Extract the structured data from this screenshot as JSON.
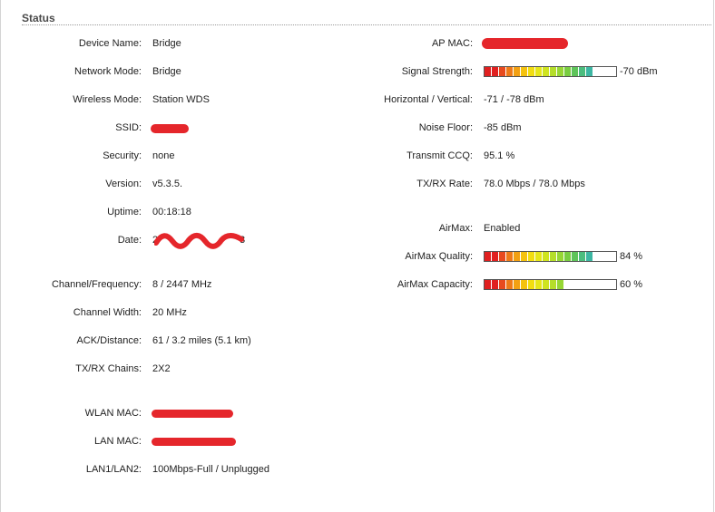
{
  "section_title": "Status",
  "left": {
    "device_name": {
      "label": "Device Name:",
      "value": "Bridge"
    },
    "network_mode": {
      "label": "Network Mode:",
      "value": "Bridge"
    },
    "wireless_mode": {
      "label": "Wireless Mode:",
      "value": "Station WDS"
    },
    "ssid": {
      "label": "SSID:",
      "value": ""
    },
    "security": {
      "label": "Security:",
      "value": "none"
    },
    "version": {
      "label": "Version:",
      "value": "v5.3.5."
    },
    "uptime": {
      "label": "Uptime:",
      "value": "00:18:18"
    },
    "date": {
      "label": "Date:",
      "value_start": "2",
      "value_end": "3"
    },
    "channel_frequency": {
      "label": "Channel/Frequency:",
      "value": "8 / 2447 MHz"
    },
    "channel_width": {
      "label": "Channel Width:",
      "value": "20 MHz"
    },
    "ack_distance": {
      "label": "ACK/Distance:",
      "value": "61 / 3.2 miles (5.1 km)"
    },
    "txrx_chains": {
      "label": "TX/RX Chains:",
      "value": "2X2"
    },
    "wlan_mac": {
      "label": "WLAN MAC:",
      "value": ""
    },
    "lan_mac": {
      "label": "LAN MAC:",
      "value": ""
    },
    "lan_ports": {
      "label": "LAN1/LAN2:",
      "value": "100Mbps-Full / Unplugged"
    }
  },
  "right": {
    "ap_mac": {
      "label": "AP MAC:",
      "value": ""
    },
    "signal_strength": {
      "label": "Signal Strength:",
      "value": "-70 dBm",
      "level": 0.86
    },
    "horizontal_vertical": {
      "label": "Horizontal / Vertical:",
      "value": "-71 / -78 dBm"
    },
    "noise_floor": {
      "label": "Noise Floor:",
      "value": "-85 dBm"
    },
    "transmit_ccq": {
      "label": "Transmit CCQ:",
      "value": "95.1 %"
    },
    "txrx_rate": {
      "label": "TX/RX Rate:",
      "value": "78.0 Mbps / 78.0 Mbps"
    },
    "airmax": {
      "label": "AirMax:",
      "value": "Enabled"
    },
    "airmax_quality": {
      "label": "AirMax Quality:",
      "value": "84 %",
      "level": 0.84
    },
    "airmax_capacity": {
      "label": "AirMax Capacity:",
      "value": "60 %",
      "level": 0.6
    }
  },
  "colors": {
    "redaction": "#e5262b",
    "bar_gradient": [
      "#e02020",
      "#e84a1e",
      "#ee7a18",
      "#f2a012",
      "#f5c20e",
      "#f2dd10",
      "#e6e618",
      "#cfe420",
      "#b5de2a",
      "#96d634",
      "#79cd40",
      "#5ec45a",
      "#4bbd7e",
      "#3cb6a2"
    ]
  }
}
